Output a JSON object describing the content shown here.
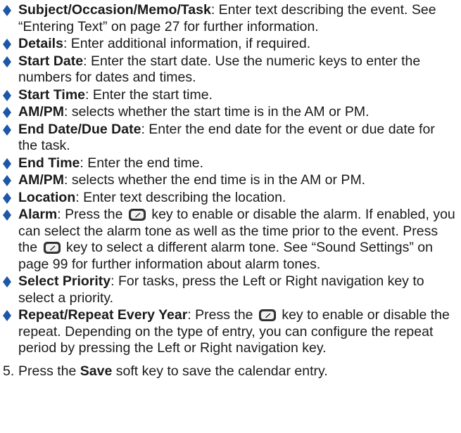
{
  "items": [
    {
      "term": "Subject/Occasion/Memo/Task",
      "segments": [
        {
          "type": "text",
          "value": ": Enter text describing the event. See “Entering Text” on page 27 for further information."
        }
      ]
    },
    {
      "term": "Details",
      "segments": [
        {
          "type": "text",
          "value": ": Enter additional information, if required."
        }
      ]
    },
    {
      "term": "Start Date",
      "segments": [
        {
          "type": "text",
          "value": ": Enter the start date. Use the numeric keys to enter the numbers for dates and times."
        }
      ]
    },
    {
      "term": "Start Time",
      "segments": [
        {
          "type": "text",
          "value": ": Enter the start time."
        }
      ]
    },
    {
      "term": "AM/PM",
      "segments": [
        {
          "type": "text",
          "value": ": selects whether the start time is in the AM or PM."
        }
      ]
    },
    {
      "term": "End Date/Due Date",
      "segments": [
        {
          "type": "text",
          "value": ": Enter the end date for the event or due date for the task."
        }
      ]
    },
    {
      "term": "End Time",
      "segments": [
        {
          "type": "text",
          "value": ": Enter the end time."
        }
      ]
    },
    {
      "term": "AM/PM",
      "segments": [
        {
          "type": "text",
          "value": ": selects whether the end time is in the AM or PM."
        }
      ]
    },
    {
      "term": "Location",
      "segments": [
        {
          "type": "text",
          "value": ": Enter text describing the location."
        }
      ]
    },
    {
      "term": "Alarm",
      "segments": [
        {
          "type": "text",
          "value": ": Press the "
        },
        {
          "type": "icon",
          "name": "select-key-icon"
        },
        {
          "type": "text",
          "value": " key to enable or disable the alarm. If enabled, you can select the alarm tone as well as the time prior to the event. Press the "
        },
        {
          "type": "icon",
          "name": "select-key-icon"
        },
        {
          "type": "text",
          "value": " key to select a different alarm tone. See “Sound Settings” on page 99 for further information about alarm tones."
        }
      ]
    },
    {
      "term": "Select Priority",
      "segments": [
        {
          "type": "text",
          "value": ": For tasks, press the Left or Right navigation key to select a priority."
        }
      ]
    },
    {
      "term": "Repeat/Repeat Every Year",
      "segments": [
        {
          "type": "text",
          "value": ": Press the "
        },
        {
          "type": "icon",
          "name": "select-key-icon"
        },
        {
          "type": "text",
          "value": " key to enable or disable the repeat. Depending on the type of entry, you can configure the repeat period by pressing the Left or Right navigation key."
        }
      ]
    }
  ],
  "step": {
    "number": "5.",
    "before": "Press the ",
    "bold": "Save",
    "after": " soft key to save the calendar entry."
  },
  "colors": {
    "bullet": "#1d57a8",
    "text": "#1a1a1a"
  }
}
